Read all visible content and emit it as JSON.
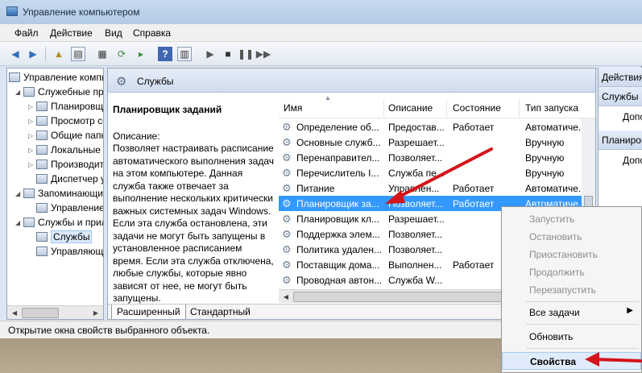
{
  "window": {
    "title": "Управление компьютером"
  },
  "menu": [
    "Файл",
    "Действие",
    "Вид",
    "Справка"
  ],
  "tree": {
    "items": [
      {
        "label": "Управление компьютером (локальным)"
      },
      {
        "label": "Служебные программы"
      },
      {
        "label": "Планировщик заданий"
      },
      {
        "label": "Просмотр событий"
      },
      {
        "label": "Общие папки"
      },
      {
        "label": "Локальные пользователи"
      },
      {
        "label": "Производительность"
      },
      {
        "label": "Диспетчер устройств"
      },
      {
        "label": "Запоминающие устройства"
      },
      {
        "label": "Управление дисками"
      },
      {
        "label": "Службы и приложения"
      },
      {
        "label": "Службы"
      },
      {
        "label": "Управляющий элемент WMI"
      }
    ]
  },
  "main": {
    "header_title": "Службы",
    "selected_service_title": "Планировщик заданий",
    "description_label": "Описание:",
    "description_text": "Позволяет настраивать расписание автоматического выполнения задач на этом компьютере. Данная служба также отвечает за выполнение нескольких критически важных системных задач Windows. Если эта служба остановлена, эти задачи не могут быть запущены в установленное расписанием время. Если эта служба отключена, любые службы, которые явно зависят от нее, не могут быть запущены.",
    "columns": [
      "Имя",
      "Описание",
      "Состояние",
      "Тип запуска"
    ],
    "rows": [
      {
        "name": "Определение об...",
        "desc": "Предостав...",
        "state": "Работает",
        "startup": "Автоматиче..."
      },
      {
        "name": "Основные служб...",
        "desc": "Разрешает...",
        "state": "",
        "startup": "Вручную"
      },
      {
        "name": "Перенаправител...",
        "desc": "Позволяет...",
        "state": "",
        "startup": "Вручную"
      },
      {
        "name": "Перечислитель I...",
        "desc": "Служба пе...",
        "state": "",
        "startup": "Вручную"
      },
      {
        "name": "Питание",
        "desc": "Управлен...",
        "state": "Работает",
        "startup": "Автоматиче..."
      },
      {
        "name": "Планировщик за...",
        "desc": "Позволяет...",
        "state": "Работает",
        "startup": "Автоматиче..."
      },
      {
        "name": "Планировщик кл...",
        "desc": "Разрешает...",
        "state": "",
        "startup": ""
      },
      {
        "name": "Поддержка элем...",
        "desc": "Позволяет...",
        "state": "",
        "startup": ""
      },
      {
        "name": "Политика удален...",
        "desc": "Позволяет...",
        "state": "",
        "startup": ""
      },
      {
        "name": "Поставщик дома...",
        "desc": "Выполнен...",
        "state": "Работает",
        "startup": ""
      },
      {
        "name": "Проводная автон...",
        "desc": "Служба W...",
        "state": "",
        "startup": ""
      }
    ],
    "tabs": [
      "Расширенный",
      "Стандартный"
    ]
  },
  "actions": {
    "header": "Действия",
    "section1": "Службы",
    "section1_item": "Дополнительные действия",
    "section2": "Планировщик заданий",
    "section2_item": "Дополнительные действия"
  },
  "status": "Открытие окна свойств выбранного объекта.",
  "context_menu": [
    {
      "label": "Запустить",
      "disabled": true
    },
    {
      "label": "Остановить",
      "disabled": true
    },
    {
      "label": "Приостановить",
      "disabled": true
    },
    {
      "label": "Продолжить",
      "disabled": true
    },
    {
      "label": "Перезапустить",
      "disabled": true
    },
    {
      "label": "Все задачи",
      "disabled": false
    },
    {
      "label": "Обновить",
      "disabled": false
    },
    {
      "label": "Свойства",
      "disabled": false
    }
  ],
  "colors": {
    "selection": "#3399ff",
    "arrow": "#d4141a"
  }
}
